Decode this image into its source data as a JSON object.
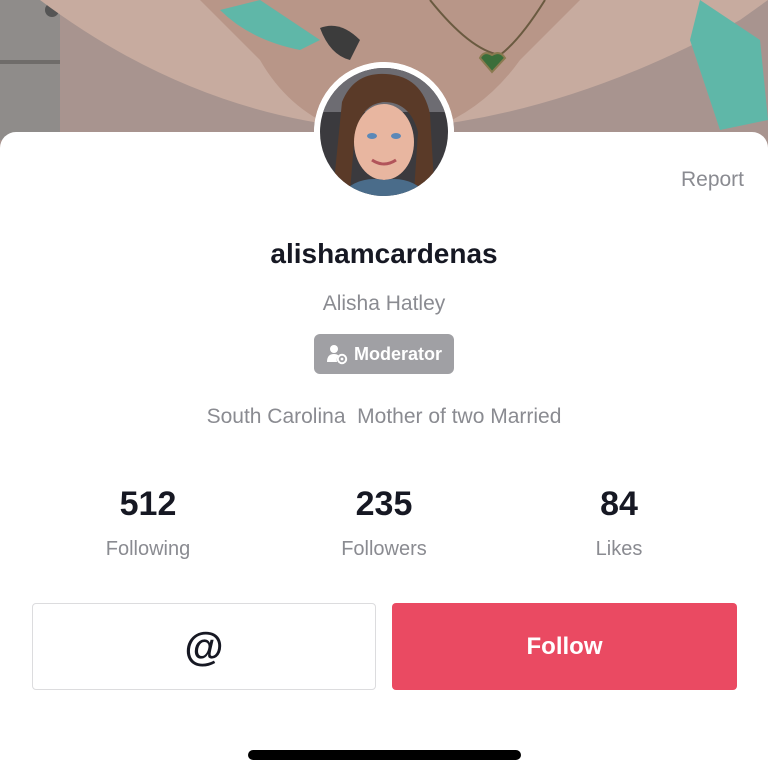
{
  "profile": {
    "username": "alishamcardenas",
    "display_name": "Alisha Hatley",
    "badge_label": "Moderator",
    "bio": "South Carolina  Mother of two Married",
    "report_label": "Report"
  },
  "stats": {
    "following": {
      "value": "512",
      "label": "Following"
    },
    "followers": {
      "value": "235",
      "label": "Followers"
    },
    "likes": {
      "value": "84",
      "label": "Likes"
    }
  },
  "actions": {
    "mention_symbol": "@",
    "follow_label": "Follow"
  },
  "icons": {
    "badge_icon": "moderator-user-gear-icon",
    "mention_icon": "at-sign-icon"
  },
  "colors": {
    "follow_button": "#ea4a62",
    "badge_background": "#a0a0a4",
    "primary_text": "#161823",
    "secondary_text": "#8a8b91"
  }
}
